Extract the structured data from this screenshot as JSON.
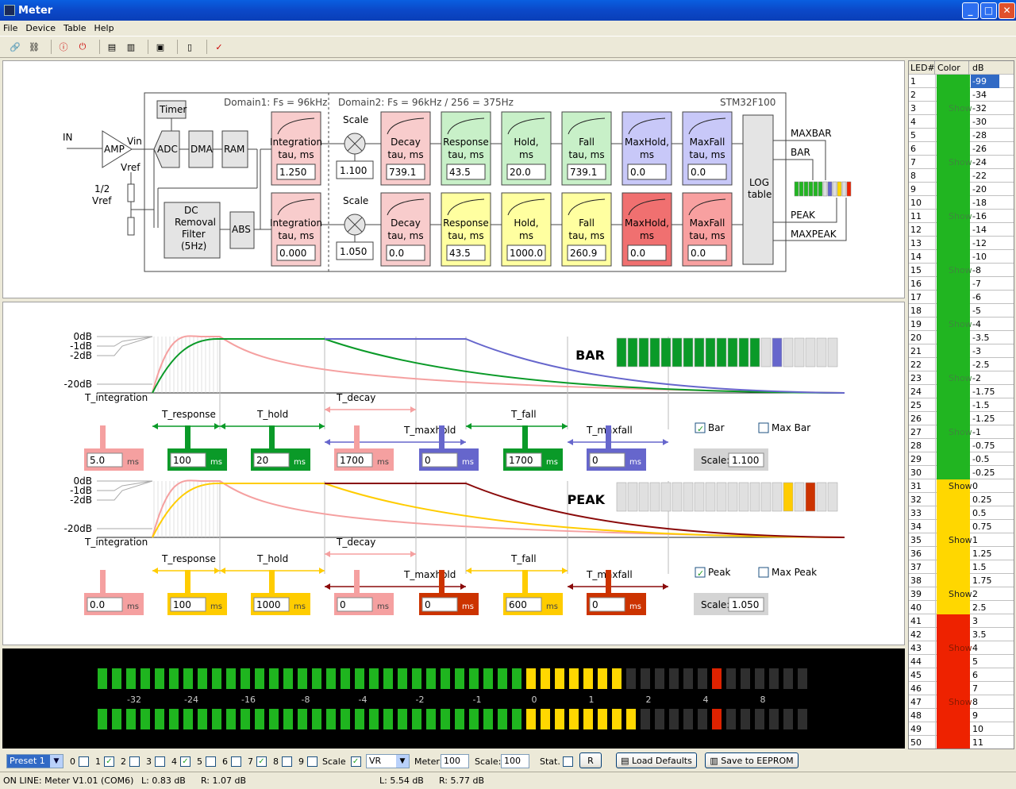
{
  "window": {
    "title": "Meter"
  },
  "menu": [
    "File",
    "Device",
    "Table",
    "Help"
  ],
  "diagram": {
    "domain1": "Domain1: Fs = 96kHz",
    "domain2": "Domain2: Fs = 96kHz / 256 = 375Hz",
    "chip": "STM32F100",
    "in": "IN",
    "amp": "AMP",
    "vin": "Vin",
    "vref": "Vref",
    "halfvref1": "1/2",
    "halfvref2": "Vref",
    "timer": "Timer",
    "adc": "ADC",
    "dma": "DMA",
    "ram": "RAM",
    "abs": "ABS",
    "dc": [
      "DC",
      "Removal",
      "Filter",
      "(5Hz)"
    ],
    "scale": "Scale",
    "log": [
      "LOG",
      "table"
    ],
    "outputs": [
      "MAXBAR",
      "BAR",
      "PEAK",
      "MAXPEAK"
    ],
    "top": {
      "integration": [
        "Integration",
        "tau, ms",
        "1.250"
      ],
      "scale": "1.100",
      "decay": [
        "Decay",
        "tau, ms",
        "739.1"
      ],
      "response": [
        "Response",
        "tau, ms",
        "43.5"
      ],
      "hold": [
        "Hold,",
        "ms",
        "20.0"
      ],
      "fall": [
        "Fall",
        "tau, ms",
        "739.1"
      ],
      "maxhold": [
        "MaxHold,",
        "ms",
        "0.0"
      ],
      "maxfall": [
        "MaxFall",
        "tau, ms",
        "0.0"
      ]
    },
    "bottom": {
      "integration": [
        "Integration",
        "tau, ms",
        "0.000"
      ],
      "scale": "1.050",
      "decay": [
        "Decay",
        "tau, ms",
        "0.0"
      ],
      "response": [
        "Response",
        "tau, ms",
        "43.5"
      ],
      "hold": [
        "Hold,",
        "ms",
        "1000.0"
      ],
      "fall": [
        "Fall",
        "tau, ms",
        "260.9"
      ],
      "maxhold": [
        "MaxHold,",
        "ms",
        "0.0"
      ],
      "maxfall": [
        "MaxFall",
        "tau, ms",
        "0.0"
      ]
    }
  },
  "timing": {
    "db_labels": [
      "0dB",
      "-1dB",
      "-2dB",
      "-20dB"
    ],
    "labels": [
      "T_integration",
      "T_response",
      "T_hold",
      "T_decay",
      "T_maxhold",
      "T_fall",
      "T_maxfall"
    ],
    "ms": "ms",
    "bar": {
      "title": "BAR",
      "values": [
        "5.0",
        "100",
        "20",
        "1700",
        "0",
        "1700",
        "0"
      ],
      "check1": "Bar",
      "check2": "Max Bar",
      "scale_label": "Scale:",
      "scale": "1.100"
    },
    "peak": {
      "title": "PEAK",
      "values": [
        "0.0",
        "100",
        "1000",
        "0",
        "0",
        "600",
        "0"
      ],
      "check1": "Peak",
      "check2": "Max Peak",
      "scale_label": "Scale:",
      "scale": "1.050"
    }
  },
  "meter_scale": [
    "-32",
    "-24",
    "-16",
    "-8",
    "-4",
    "-2",
    "-1",
    "0",
    "1",
    "2",
    "4",
    "8"
  ],
  "bottombar": {
    "preset": "Preset 1",
    "checks": [
      "0",
      "1",
      "2",
      "3",
      "4",
      "5",
      "6",
      "7",
      "8",
      "9"
    ],
    "scale_label": "Scale",
    "mode": "VR",
    "meter_label": "Meter:",
    "meter": "100",
    "scale2_label": "Scale:",
    "scale2": "100",
    "stat": "Stat.",
    "r": "R",
    "load": "Load Defaults",
    "save": "Save to EEPROM"
  },
  "status": {
    "online": "ON LINE: Meter V1.01 (COM6)",
    "l1": "L: 0.83 dB",
    "r1": "R: 1.07 dB",
    "l2": "L: 5.54 dB",
    "r2": "R: 5.77 dB"
  },
  "led_table": {
    "headers": [
      "LED#",
      "Color",
      "dB"
    ],
    "show": "Show",
    "db": [
      "-99",
      "-34",
      "-32",
      "-30",
      "-28",
      "-26",
      "-24",
      "-22",
      "-20",
      "-18",
      "-16",
      "-14",
      "-12",
      "-10",
      "-8",
      "-7",
      "-6",
      "-5",
      "-4",
      "-3.5",
      "-3",
      "-2.5",
      "-2",
      "-1.75",
      "-1.5",
      "-1.25",
      "-1",
      "-0.75",
      "-0.5",
      "-0.25",
      "0",
      "0.25",
      "0.5",
      "0.75",
      "1",
      "1.25",
      "1.5",
      "1.75",
      "2",
      "2.5",
      "3",
      "3.5",
      "4",
      "5",
      "6",
      "7",
      "8",
      "9",
      "10",
      "11"
    ],
    "show_rows": [
      3,
      7,
      11,
      15,
      19,
      23,
      27,
      31,
      35,
      39,
      43,
      47
    ],
    "colors": {
      "green": "#21b521",
      "yellow": "#ffd700",
      "red": "#ee2200"
    }
  },
  "colors": {
    "pink": "#f5a0a0",
    "green": "#0a9a28",
    "blue": "#6666cc",
    "yellow": "#ffcc00",
    "darkred": "#8a0a0a",
    "red": "#cc3300"
  }
}
